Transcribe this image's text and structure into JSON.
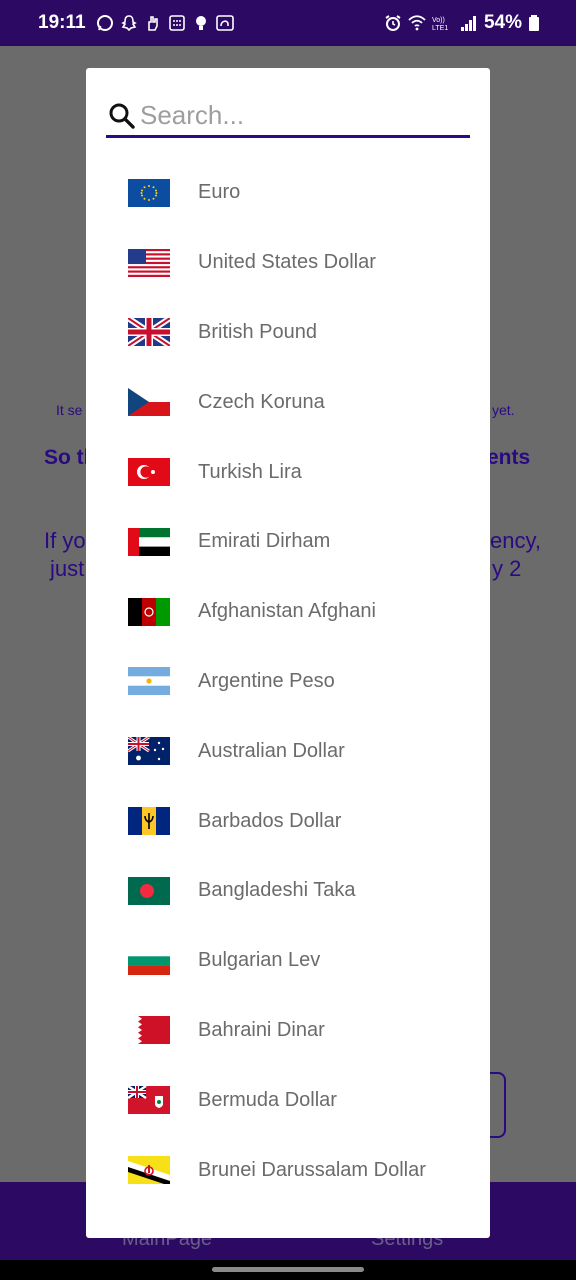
{
  "status_bar": {
    "time": "19:11",
    "battery": "54%",
    "network": "Vo)) LTE1"
  },
  "background": {
    "line1_left": "It se",
    "line1_right": "yet.",
    "line2_left": "So th",
    "line2_right": "ents",
    "line3_left": "If yo",
    "line3_right": "ency,",
    "line4_left": "just",
    "line4_right": "y 2",
    "nav_main": "MainPage",
    "nav_settings": "Settings"
  },
  "search": {
    "placeholder": "Search..."
  },
  "currencies": [
    {
      "name": "Euro",
      "flag": "eu-flag-icon"
    },
    {
      "name": "United States Dollar",
      "flag": "us-flag-icon"
    },
    {
      "name": "British Pound",
      "flag": "gb-flag-icon"
    },
    {
      "name": "Czech Koruna",
      "flag": "cz-flag-icon"
    },
    {
      "name": "Turkish Lira",
      "flag": "tr-flag-icon"
    },
    {
      "name": "Emirati Dirham",
      "flag": "ae-flag-icon"
    },
    {
      "name": "Afghanistan Afghani",
      "flag": "af-flag-icon"
    },
    {
      "name": "Argentine Peso",
      "flag": "ar-flag-icon"
    },
    {
      "name": "Australian Dollar",
      "flag": "au-flag-icon"
    },
    {
      "name": "Barbados Dollar",
      "flag": "bb-flag-icon"
    },
    {
      "name": "Bangladeshi Taka",
      "flag": "bd-flag-icon"
    },
    {
      "name": "Bulgarian Lev",
      "flag": "bg-flag-icon"
    },
    {
      "name": "Bahraini Dinar",
      "flag": "bh-flag-icon"
    },
    {
      "name": "Bermuda Dollar",
      "flag": "bm-flag-icon"
    },
    {
      "name": "Brunei Darussalam Dollar",
      "flag": "bn-flag-icon"
    }
  ],
  "colors": {
    "accent": "#2c0a82",
    "status_bar_bg": "#2c0a64",
    "scrim": "#6b6b6b",
    "item_text": "#6b6b6b"
  }
}
